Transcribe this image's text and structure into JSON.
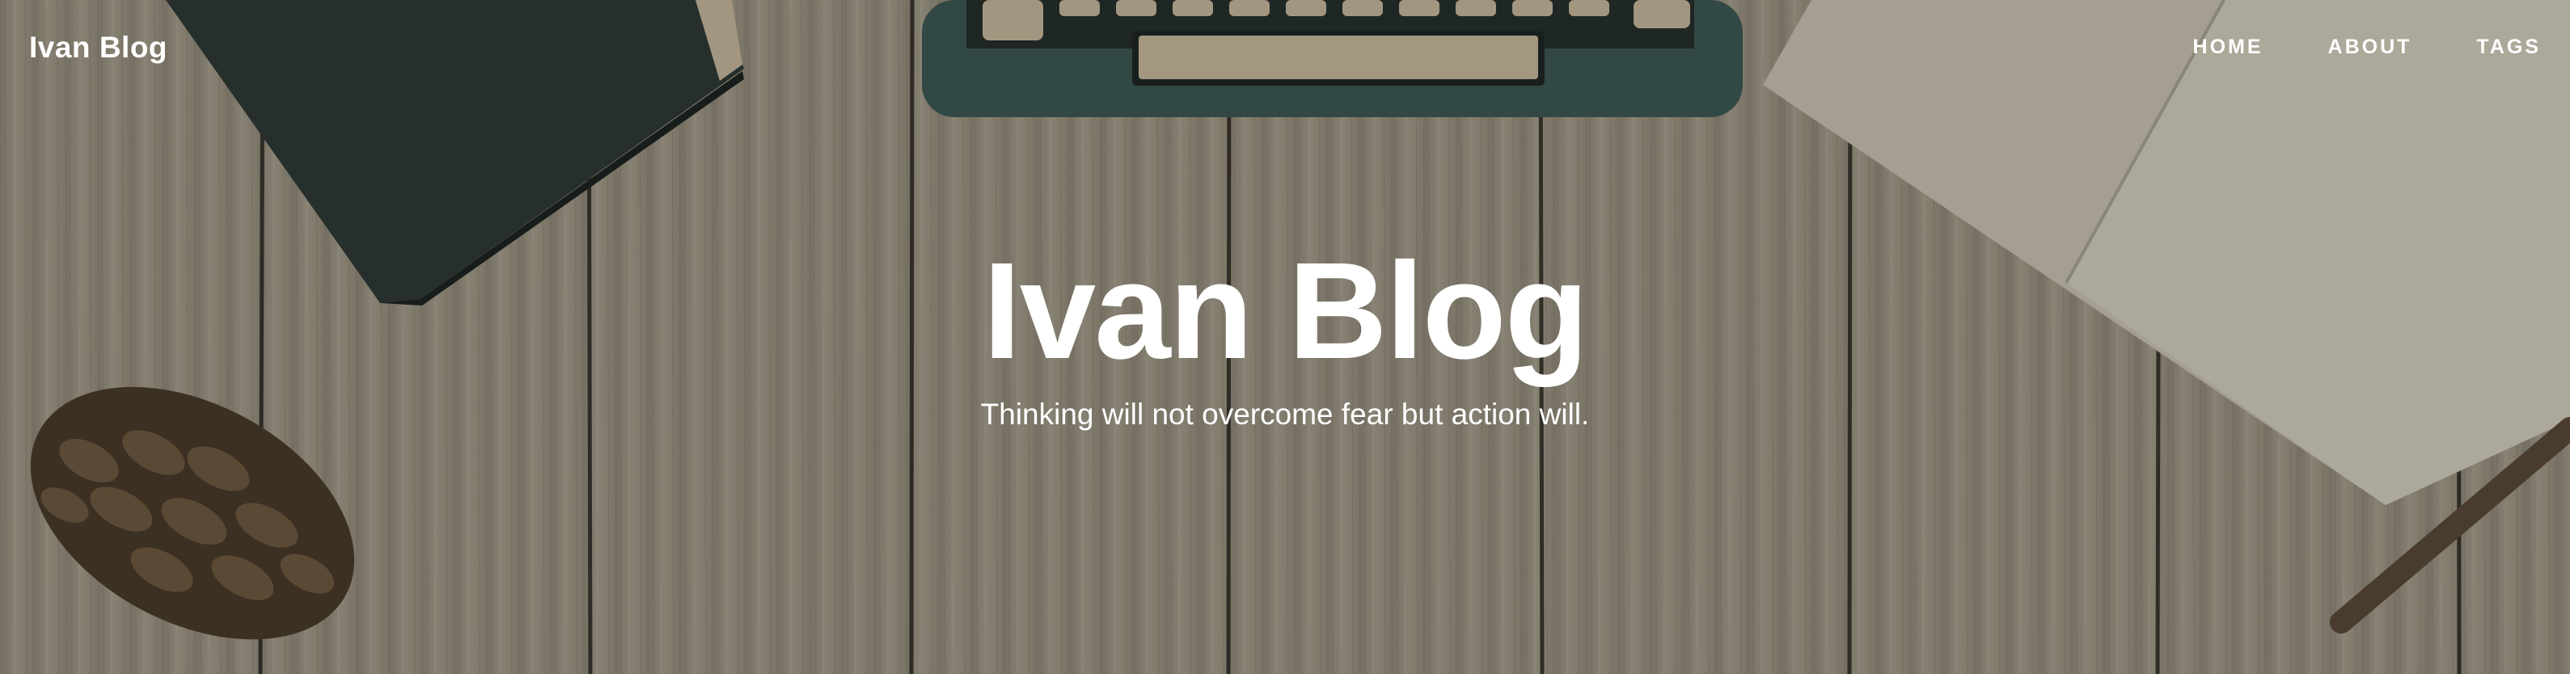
{
  "navbar": {
    "brand": "Ivan Blog",
    "links": [
      {
        "label": "HOME"
      },
      {
        "label": "ABOUT"
      },
      {
        "label": "TAGS"
      }
    ]
  },
  "hero": {
    "title": "Ivan Blog",
    "subtitle": "Thinking will not overcome fear but action will.",
    "background": "wooden-desk-photo-with-typewriter-book-notebook-pinecone"
  },
  "colors": {
    "text": "#ffffff",
    "wood": "#a79f8d",
    "book": "#2e3a35",
    "typewriter": "#3d5752",
    "paper": "#c9c4b2"
  }
}
